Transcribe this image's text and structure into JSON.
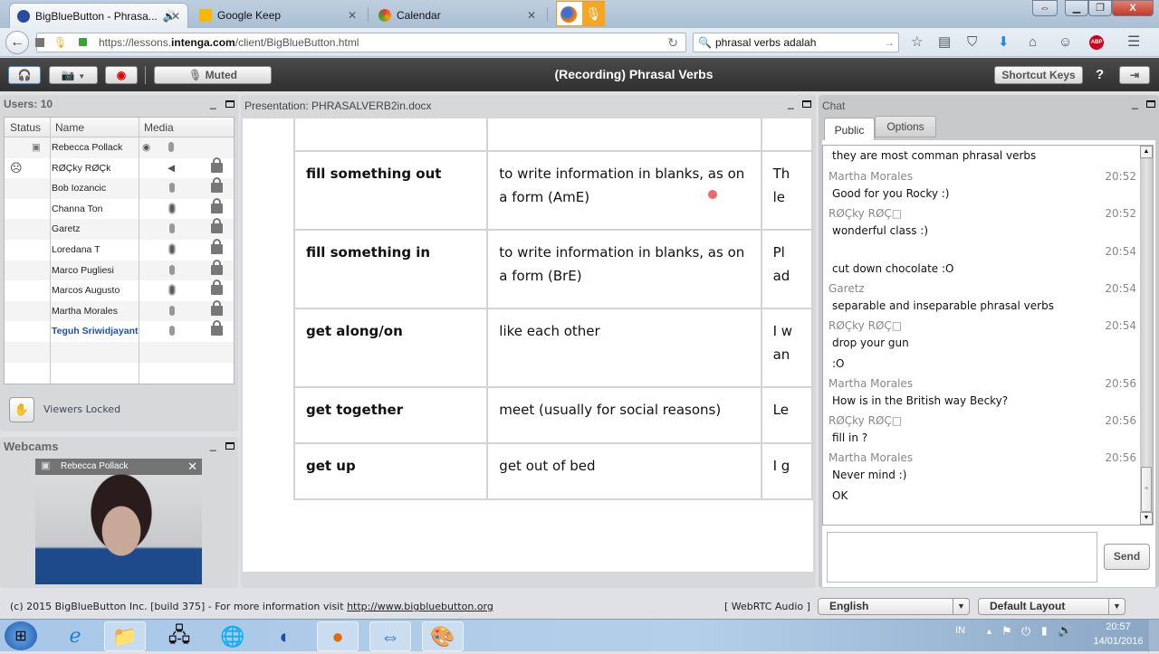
{
  "browser": {
    "tabs": [
      {
        "label": "BigBlueButton - Phrasa...",
        "active": true,
        "audio_icon": "speaker-icon"
      },
      {
        "label": "Google Keep",
        "active": false
      },
      {
        "label": "Calendar",
        "active": false
      }
    ],
    "url": {
      "prefix": "https://lessons.",
      "domain": "intenga.com",
      "path": "/client/BigBlueButton.html"
    },
    "search_value": "phrasal verbs adalah",
    "toolbar_icons": [
      "bookmark-star-icon",
      "reading-list-icon",
      "pocket-icon",
      "download-icon",
      "home-icon",
      "chat-bubble-icon",
      "adblock-icon",
      "menu-icon"
    ]
  },
  "bbb_toolbar": {
    "muted_label": "Muted",
    "title": "(Recording) Phrasal Verbs",
    "shortcut_keys_label": "Shortcut Keys",
    "help_label": "?"
  },
  "users_panel": {
    "title": "Users: 10",
    "columns": [
      "Status",
      "Name",
      "Media"
    ],
    "users": [
      {
        "name": "Rebecca Pollack",
        "status": "presenter",
        "media": "webcam+mic",
        "locked": false
      },
      {
        "name": "RØÇky RØÇk",
        "status": "sad",
        "media": "listen-only",
        "locked": true
      },
      {
        "name": "Bob Iozancic",
        "status": "",
        "media": "mic-muted",
        "locked": true
      },
      {
        "name": "Channa Ton",
        "status": "",
        "media": "mic-talking",
        "locked": true
      },
      {
        "name": "Garetz",
        "status": "",
        "media": "mic-muted",
        "locked": true
      },
      {
        "name": "Loredana T",
        "status": "",
        "media": "mic-talking",
        "locked": true
      },
      {
        "name": "Marco Pugliesi",
        "status": "",
        "media": "mic-muted",
        "locked": true
      },
      {
        "name": "Marcos Augusto",
        "status": "",
        "media": "mic-talking",
        "locked": true
      },
      {
        "name": "Martha Morales",
        "status": "",
        "media": "mic-muted",
        "locked": true
      },
      {
        "name": "Teguh Sriwidjayanti",
        "status": "",
        "media": "mic-muted",
        "locked": true,
        "is_self": true
      }
    ],
    "viewers_locked_label": "Viewers Locked"
  },
  "webcams_panel": {
    "title": "Webcams",
    "feed_name": "Rebecca Pollack"
  },
  "presentation_panel": {
    "title": "Presentation: PHRASALVERB2in.docx",
    "rows": [
      {
        "verb": "",
        "definition": "",
        "example": ""
      },
      {
        "verb": "fill something out",
        "definition": "to write information in blanks, as on a form (AmE)",
        "example": "Th le"
      },
      {
        "verb": "fill something in",
        "definition": "to write information in blanks, as on a form (BrE)",
        "example": "Pl ad"
      },
      {
        "verb": "get along/on",
        "definition": "like each other",
        "example": "I w an"
      },
      {
        "verb": "get together",
        "definition": "meet (usually for social reasons)",
        "example": "Le"
      },
      {
        "verb": "get up",
        "definition": "get out of bed",
        "example": "I g"
      }
    ]
  },
  "chat_panel": {
    "title": "Chat",
    "tabs": [
      "Public",
      "Options"
    ],
    "messages": [
      {
        "name": "",
        "time": "",
        "lines": [
          "they are most comman phrasal verbs"
        ]
      },
      {
        "name": "Martha Morales",
        "time": "20:52",
        "lines": [
          "Good for you Rocky :)"
        ]
      },
      {
        "name": "RØÇky RØÇ□",
        "time": "20:52",
        "lines": [
          "wonderful class :)"
        ]
      },
      {
        "name": "",
        "time": "20:54",
        "lines": [
          "cut down chocolate :O"
        ]
      },
      {
        "name": "Garetz",
        "time": "20:54",
        "lines": [
          "separable and inseparable phrasal verbs"
        ]
      },
      {
        "name": "RØÇky RØÇ□",
        "time": "20:54",
        "lines": [
          "drop your gun",
          ":O"
        ]
      },
      {
        "name": "Martha Morales",
        "time": "20:56",
        "lines": [
          "How is in the British way Becky?"
        ]
      },
      {
        "name": "RØÇky RØÇ□",
        "time": "20:56",
        "lines": [
          "fill in ?"
        ]
      },
      {
        "name": "Martha Morales",
        "time": "20:56",
        "lines": [
          "Never mind :)",
          "OK"
        ]
      }
    ],
    "input_value": "",
    "send_label": "Send"
  },
  "footer": {
    "copyright": "(c) 2015 BigBlueButton Inc. [build 375] - For more information visit ",
    "link": "http://www.bigbluebutton.org",
    "audio_mode": "[ WebRTC Audio ]",
    "language": "English",
    "layout": "Default Layout"
  },
  "taskbar": {
    "apps": [
      "start-button",
      "internet-explorer-icon",
      "file-explorer-icon",
      "network-tool-icon",
      "globe-icon",
      "winbox-icon",
      "firefox-icon",
      "teamviewer-icon",
      "paint-icon"
    ],
    "lang": "IN",
    "time": "20:57",
    "date": "14/01/2016"
  }
}
